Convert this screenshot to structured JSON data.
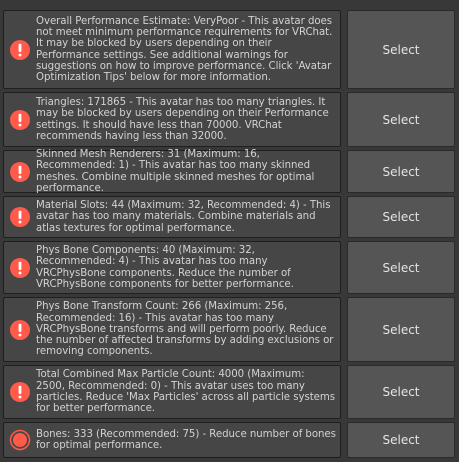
{
  "colors": {
    "error_icon": "#ff5a4a",
    "background": "#383838",
    "message_box": "#464646",
    "button": "#555555"
  },
  "warnings": [
    {
      "icon": "error-icon",
      "text": "Overall Performance Estimate: VeryPoor - This avatar does not meet minimum performance requirements for VRChat. It may be blocked by users depending on their Performance settings. See additional warnings for suggestions on how to improve performance. Click 'Avatar Optimization Tips' below for more information.",
      "button_label": "Select"
    },
    {
      "icon": "error-icon",
      "text": "Triangles: 171865 - This avatar has too many triangles. It may be blocked by users depending on their Performance settings. It should have less than 70000. VRChat recommends having less than 32000.",
      "button_label": "Select"
    },
    {
      "icon": "error-icon",
      "text": "Skinned Mesh Renderers: 31 (Maximum: 16, Recommended: 1) - This avatar has too many skinned meshes. Combine multiple skinned meshes for optimal performance.",
      "button_label": "Select"
    },
    {
      "icon": "error-icon",
      "text": "Material Slots: 44 (Maximum: 32, Recommended: 4) - This avatar has too many materials. Combine materials and atlas textures for optimal performance.",
      "button_label": "Select"
    },
    {
      "icon": "error-icon",
      "text": "Phys Bone Components: 40 (Maximum: 32, Recommended: 4) - This avatar has too many VRCPhysBone components. Reduce the number of VRCPhysBone components for better performance.",
      "button_label": "Select"
    },
    {
      "icon": "error-icon",
      "text": "Phys Bone Transform Count: 266 (Maximum: 256, Recommended: 16) - This avatar has too many VRCPhysBone transforms and will perform poorly. Reduce the number of affected transforms by adding exclusions or removing components.",
      "button_label": "Select"
    },
    {
      "icon": "error-icon",
      "text": "Total Combined Max Particle Count: 4000 (Maximum: 2500, Recommended: 0) - This avatar uses too many particles. Reduce 'Max Particles' across all particle systems for better performance.",
      "button_label": "Select"
    },
    {
      "icon": "error-circle-icon",
      "text": "Bones: 333 (Recommended: 75) - Reduce number of bones for optimal performance.",
      "button_label": "Select"
    }
  ]
}
